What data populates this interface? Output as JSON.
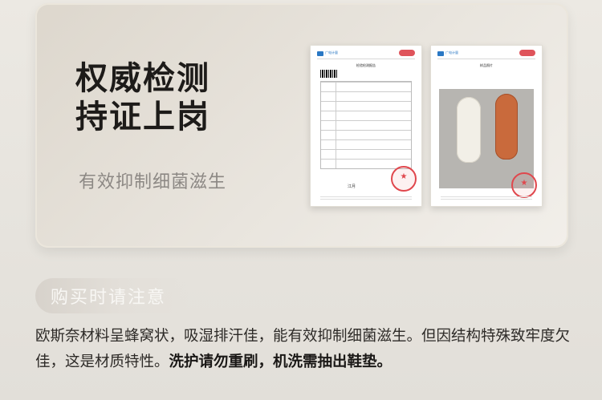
{
  "hero": {
    "headline_line1": "权威检测",
    "headline_line2": "持证上岗",
    "subline": "有效抑制细菌滋生"
  },
  "documents": {
    "report": {
      "issuer_name": "广电计量",
      "title": "检验检测报告",
      "signature": "江月"
    },
    "sample_photo": {
      "issuer_name": "广电计量",
      "title": "样品照片"
    }
  },
  "notice": {
    "label": "购买时请注意",
    "body_plain": "欧斯奈材料呈蜂窝状，吸湿排汗佳，能有效抑制细菌滋生。但因结构特殊致牢度欠佳，这是材质特性。",
    "body_bold": "洗护请勿重刷，机洗需抽出鞋垫。"
  },
  "colors": {
    "headline": "#1d1b19",
    "subline": "#8c8884",
    "stamp_red": "#e0474d",
    "brand_blue": "#2a78c4",
    "insole_orange": "#c96a3c"
  }
}
